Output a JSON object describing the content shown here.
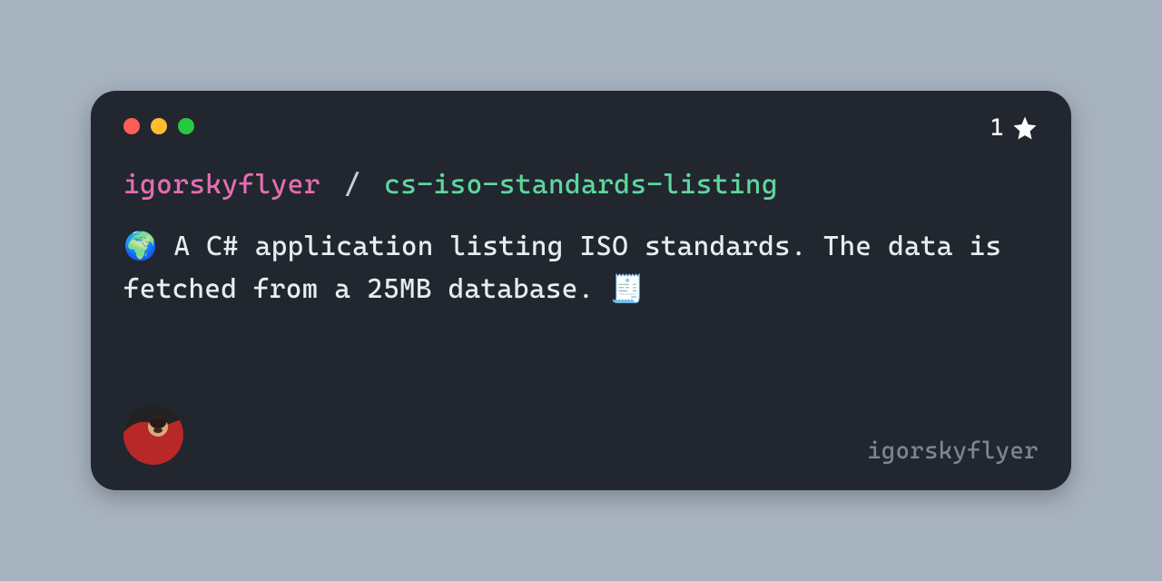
{
  "stars": {
    "count": "1"
  },
  "repo": {
    "owner": "igorskyflyer",
    "separator": "/",
    "name": "cs-iso-standards-listing"
  },
  "description": {
    "text": "🌍 A C# application listing ISO standards. The data is fetched from a 25MB database. 🧾"
  },
  "watermark": {
    "text": "igorskyflyer"
  }
}
